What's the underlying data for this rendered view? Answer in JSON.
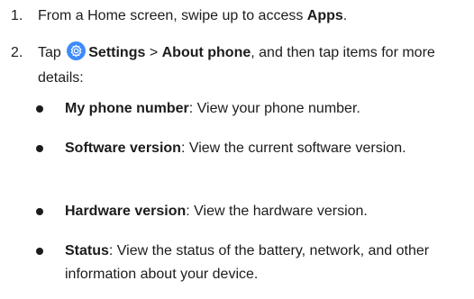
{
  "steps": [
    {
      "number": "1.",
      "text_before": "From a Home screen, swipe up to access ",
      "bold": "Apps",
      "text_after": "."
    },
    {
      "number": "2.",
      "text_tap": "Tap",
      "icon": "settings-gear-icon",
      "settings_label": "Settings",
      "separator": " > ",
      "about_label": "About phone",
      "text_after": ", and then tap items for more details:"
    }
  ],
  "bullets": [
    {
      "term": "My phone number",
      "description": ": View your phone number."
    },
    {
      "term": "Software version",
      "description": ": View the current software version."
    },
    {
      "term": "Hardware version",
      "description": ": View the hardware version."
    },
    {
      "term": "Status",
      "description": ": View the status of the battery, network, and other information about your device."
    }
  ],
  "colors": {
    "text": "#1c1c1c",
    "settings_icon_bg": "#3d8bfd"
  }
}
